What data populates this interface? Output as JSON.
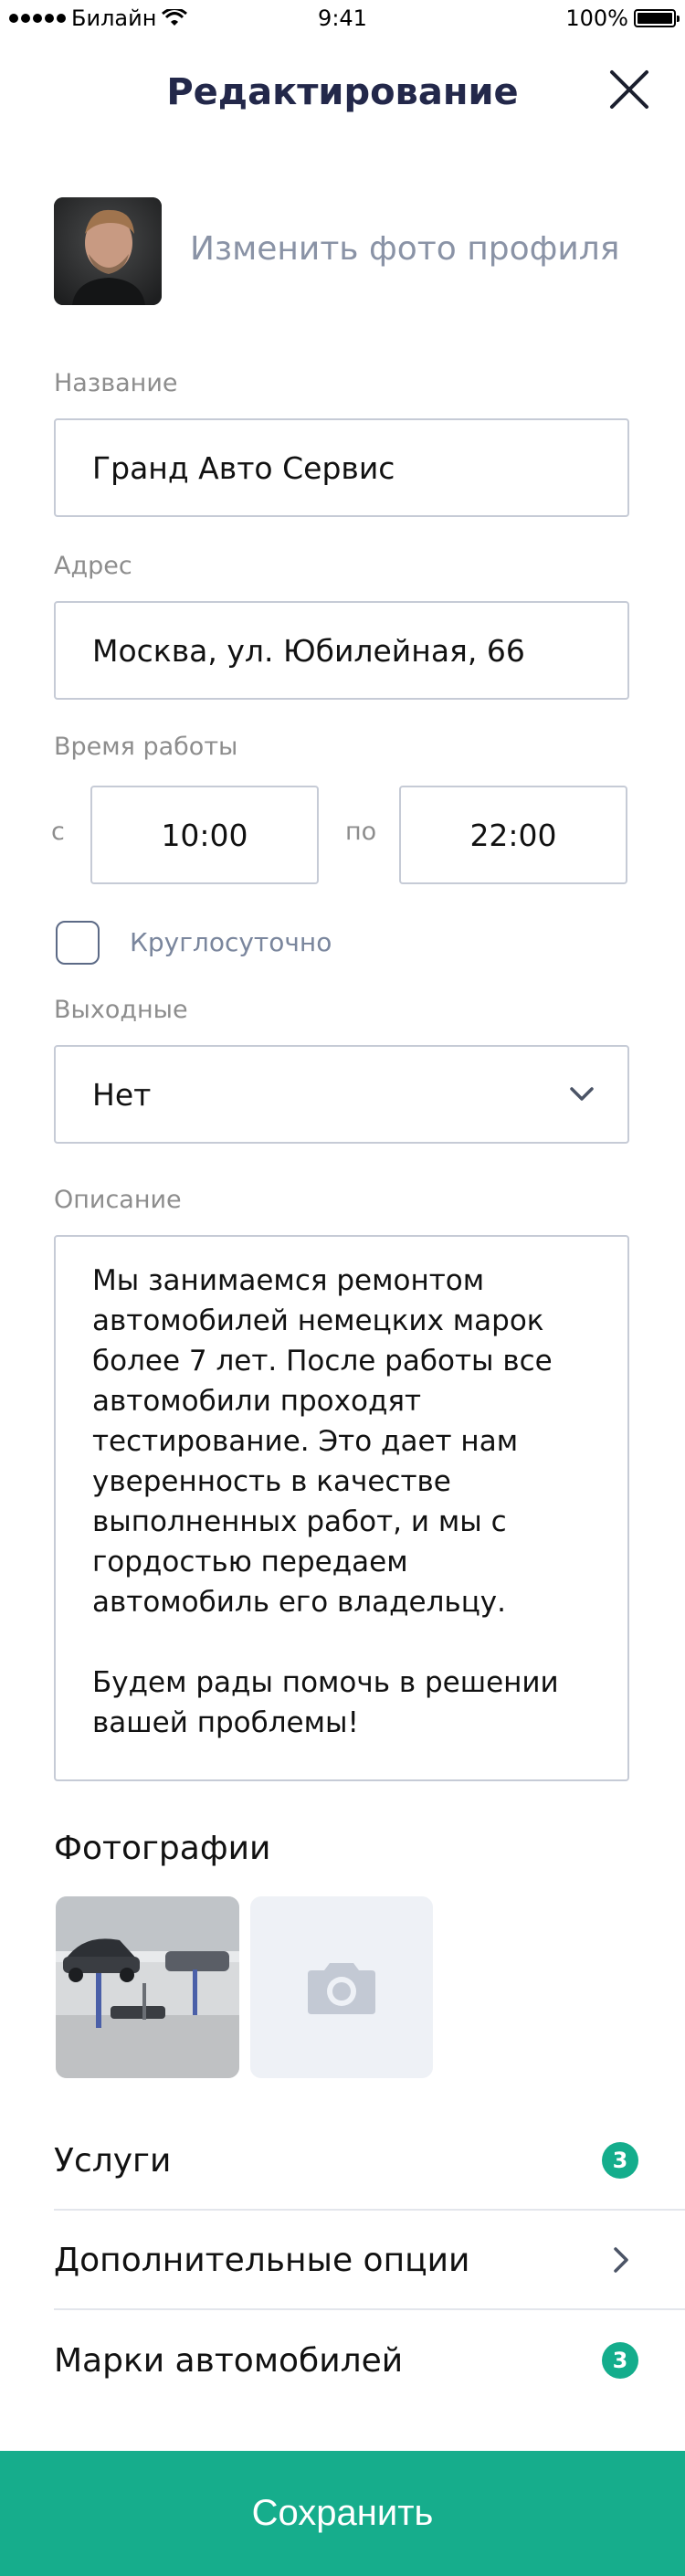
{
  "status_bar": {
    "carrier": "Билайн",
    "time": "9:41",
    "battery": "100%"
  },
  "header": {
    "title": "Редактирование"
  },
  "profile": {
    "change_photo_label": "Изменить фото профиля"
  },
  "form": {
    "name": {
      "label": "Название",
      "value": "Гранд Авто Сервис"
    },
    "address": {
      "label": "Адрес",
      "value": "Москва, ул. Юбилейная, 66"
    },
    "hours": {
      "label": "Время работы",
      "from_label": "с",
      "from_value": "10:00",
      "to_label": "по",
      "to_value": "22:00"
    },
    "round_the_clock": {
      "label": "Круглосуточно",
      "checked": false
    },
    "days_off": {
      "label": "Выходные",
      "value": "Нет"
    },
    "description": {
      "label": "Описание",
      "paragraph1": "Мы занимаемся ремонтом автомобилей немецких марок более 7 лет. После работы все автомобили проходят тестирование. Это дает нам уверенность в качестве выполненных работ, и мы с гордостью передаем автомобиль его владельцу.",
      "paragraph2": "Будем рады помочь в решении вашей проблемы!"
    }
  },
  "photos": {
    "title": "Фотографии"
  },
  "menu": {
    "services": {
      "label": "Услуги",
      "badge": "3"
    },
    "extra_options": {
      "label": "Дополнительные опции"
    },
    "car_brands": {
      "label": "Марки автомобилей",
      "badge": "3"
    }
  },
  "save_label": "Сохранить",
  "colors": {
    "accent": "#16ad8c",
    "title": "#23284a",
    "muted": "#8d8d8d",
    "border": "#c6cbd6"
  },
  "icons": [
    "wifi-icon",
    "close-icon",
    "chevron-down-icon",
    "camera-icon",
    "chevron-right-icon"
  ]
}
